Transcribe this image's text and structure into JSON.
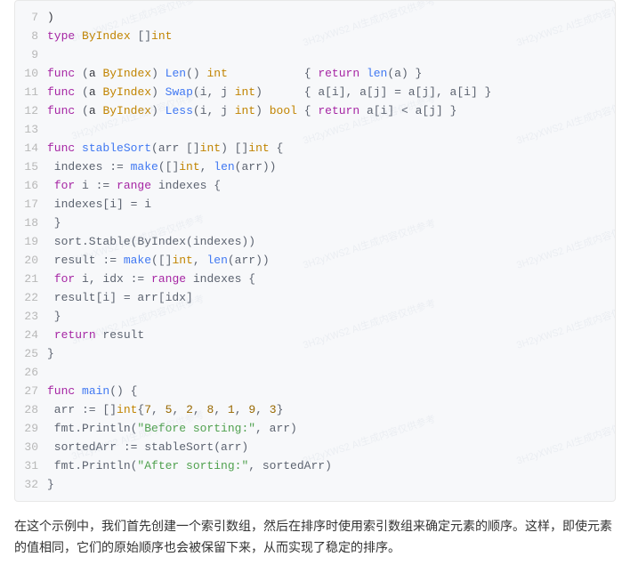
{
  "watermark": {
    "text_cn": "AI生成内容仅供参考",
    "text_id": "3H2yXWS2"
  },
  "code": {
    "lines": [
      {
        "n": 7,
        "tokens": [
          {
            "t": ")",
            "c": "pun"
          }
        ]
      },
      {
        "n": 8,
        "tokens": [
          {
            "t": "type",
            "c": "kw"
          },
          {
            "t": " "
          },
          {
            "t": "ByIndex",
            "c": "typ"
          },
          {
            "t": " []"
          },
          {
            "t": "int",
            "c": "typ"
          }
        ]
      },
      {
        "n": 9,
        "tokens": []
      },
      {
        "n": 10,
        "tokens": [
          {
            "t": "func",
            "c": "kw"
          },
          {
            "t": " ("
          },
          {
            "t": "a",
            "c": "ident"
          },
          {
            "t": " "
          },
          {
            "t": "ByIndex",
            "c": "typ"
          },
          {
            "t": ") "
          },
          {
            "t": "Len",
            "c": "fn"
          },
          {
            "t": "() "
          },
          {
            "t": "int",
            "c": "typ"
          },
          {
            "t": "           { "
          },
          {
            "t": "return",
            "c": "kw"
          },
          {
            "t": " "
          },
          {
            "t": "len",
            "c": "fn"
          },
          {
            "t": "(a) }"
          }
        ]
      },
      {
        "n": 11,
        "tokens": [
          {
            "t": "func",
            "c": "kw"
          },
          {
            "t": " ("
          },
          {
            "t": "a",
            "c": "ident"
          },
          {
            "t": " "
          },
          {
            "t": "ByIndex",
            "c": "typ"
          },
          {
            "t": ") "
          },
          {
            "t": "Swap",
            "c": "fn"
          },
          {
            "t": "(i, j "
          },
          {
            "t": "int",
            "c": "typ"
          },
          {
            "t": ")      { a[i], a[j] = a[j], a[i] }"
          }
        ]
      },
      {
        "n": 12,
        "tokens": [
          {
            "t": "func",
            "c": "kw"
          },
          {
            "t": " ("
          },
          {
            "t": "a",
            "c": "ident"
          },
          {
            "t": " "
          },
          {
            "t": "ByIndex",
            "c": "typ"
          },
          {
            "t": ") "
          },
          {
            "t": "Less",
            "c": "fn"
          },
          {
            "t": "(i, j "
          },
          {
            "t": "int",
            "c": "typ"
          },
          {
            "t": ") "
          },
          {
            "t": "bool",
            "c": "typ"
          },
          {
            "t": " { "
          },
          {
            "t": "return",
            "c": "kw"
          },
          {
            "t": " a[i] < a[j] }"
          }
        ]
      },
      {
        "n": 13,
        "tokens": []
      },
      {
        "n": 14,
        "tokens": [
          {
            "t": "func",
            "c": "kw"
          },
          {
            "t": " "
          },
          {
            "t": "stableSort",
            "c": "fn"
          },
          {
            "t": "(arr []"
          },
          {
            "t": "int",
            "c": "typ"
          },
          {
            "t": ") []"
          },
          {
            "t": "int",
            "c": "typ"
          },
          {
            "t": " {"
          }
        ]
      },
      {
        "n": 15,
        "tokens": [
          {
            "t": " indexes := "
          },
          {
            "t": "make",
            "c": "fn"
          },
          {
            "t": "([]"
          },
          {
            "t": "int",
            "c": "typ"
          },
          {
            "t": ", "
          },
          {
            "t": "len",
            "c": "fn"
          },
          {
            "t": "(arr))"
          }
        ]
      },
      {
        "n": 16,
        "tokens": [
          {
            "t": " "
          },
          {
            "t": "for",
            "c": "kw"
          },
          {
            "t": " i := "
          },
          {
            "t": "range",
            "c": "kw"
          },
          {
            "t": " indexes {"
          }
        ]
      },
      {
        "n": 17,
        "tokens": [
          {
            "t": " indexes[i] = i"
          }
        ]
      },
      {
        "n": 18,
        "tokens": [
          {
            "t": " }"
          }
        ]
      },
      {
        "n": 19,
        "tokens": [
          {
            "t": " sort.Stable(ByIndex(indexes))"
          }
        ]
      },
      {
        "n": 20,
        "tokens": [
          {
            "t": " result := "
          },
          {
            "t": "make",
            "c": "fn"
          },
          {
            "t": "([]"
          },
          {
            "t": "int",
            "c": "typ"
          },
          {
            "t": ", "
          },
          {
            "t": "len",
            "c": "fn"
          },
          {
            "t": "(arr))"
          }
        ]
      },
      {
        "n": 21,
        "tokens": [
          {
            "t": " "
          },
          {
            "t": "for",
            "c": "kw"
          },
          {
            "t": " i, idx := "
          },
          {
            "t": "range",
            "c": "kw"
          },
          {
            "t": " indexes {"
          }
        ]
      },
      {
        "n": 22,
        "tokens": [
          {
            "t": " result[i] = arr[idx]"
          }
        ]
      },
      {
        "n": 23,
        "tokens": [
          {
            "t": " }"
          }
        ]
      },
      {
        "n": 24,
        "tokens": [
          {
            "t": " "
          },
          {
            "t": "return",
            "c": "kw"
          },
          {
            "t": " result"
          }
        ]
      },
      {
        "n": 25,
        "tokens": [
          {
            "t": "}"
          }
        ]
      },
      {
        "n": 26,
        "tokens": []
      },
      {
        "n": 27,
        "tokens": [
          {
            "t": "func",
            "c": "kw"
          },
          {
            "t": " "
          },
          {
            "t": "main",
            "c": "fn"
          },
          {
            "t": "() {"
          }
        ]
      },
      {
        "n": 28,
        "tokens": [
          {
            "t": " arr := []"
          },
          {
            "t": "int",
            "c": "typ"
          },
          {
            "t": "{"
          },
          {
            "t": "7",
            "c": "num"
          },
          {
            "t": ", "
          },
          {
            "t": "5",
            "c": "num"
          },
          {
            "t": ", "
          },
          {
            "t": "2",
            "c": "num"
          },
          {
            "t": ", "
          },
          {
            "t": "8",
            "c": "num"
          },
          {
            "t": ", "
          },
          {
            "t": "1",
            "c": "num"
          },
          {
            "t": ", "
          },
          {
            "t": "9",
            "c": "num"
          },
          {
            "t": ", "
          },
          {
            "t": "3",
            "c": "num"
          },
          {
            "t": "}"
          }
        ]
      },
      {
        "n": 29,
        "tokens": [
          {
            "t": " fmt.Println("
          },
          {
            "t": "\"Before sorting:\"",
            "c": "str"
          },
          {
            "t": ", arr)"
          }
        ]
      },
      {
        "n": 30,
        "tokens": [
          {
            "t": " sortedArr := stableSort(arr)"
          }
        ]
      },
      {
        "n": 31,
        "tokens": [
          {
            "t": " fmt.Println("
          },
          {
            "t": "\"After sorting:\"",
            "c": "str"
          },
          {
            "t": ", sortedArr)"
          }
        ]
      },
      {
        "n": 32,
        "tokens": [
          {
            "t": "}"
          }
        ]
      }
    ]
  },
  "paragraph": "在这个示例中，我们首先创建一个索引数组，然后在排序时使用索引数组来确定元素的顺序。这样，即使元素的值相同，它们的原始顺序也会被保留下来，从而实现了稳定的排序。"
}
